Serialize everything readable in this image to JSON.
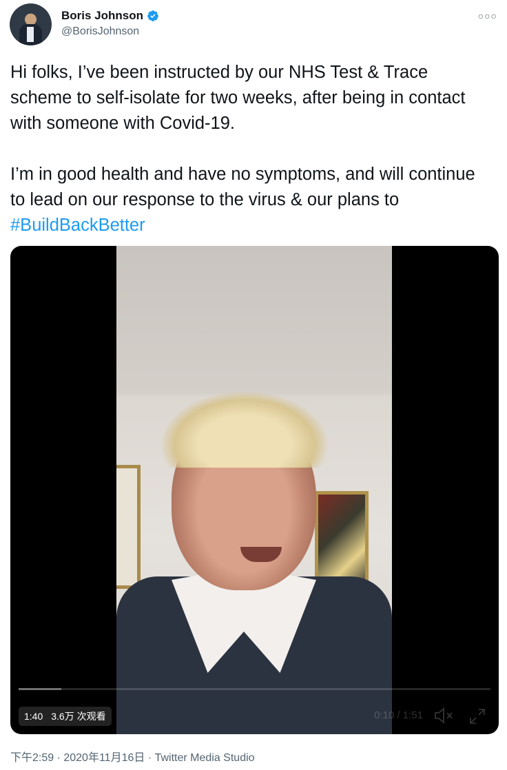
{
  "author": {
    "name": "Boris Johnson",
    "handle": "@BorisJohnson",
    "verified": true,
    "more_icon": "more-horizontal-icon"
  },
  "tweet": {
    "paragraph1": "Hi folks, I’ve been instructed by our NHS Test & Trace scheme to self-isolate for two weeks, after being in contact with someone with Covid-19.",
    "paragraph2_text": "I’m in good health and have no symptoms, and will continue to lead on our response to the virus & our plans to ",
    "hashtag": "#BuildBackBetter"
  },
  "video": {
    "duration_badge": "1:40",
    "views": "3.6万 次观看",
    "time_readout": "0:10 / 1:51",
    "progress": 0.09,
    "icons": [
      "volume-mute-icon",
      "fullscreen-icon"
    ]
  },
  "meta": {
    "timestamp": "下午2:59 · 2020年11月16日",
    "separator": " · ",
    "source": "Twitter Media Studio"
  },
  "colors": {
    "accent": "#1d9bf0",
    "text": "#0f1419",
    "secondary": "#536471"
  }
}
